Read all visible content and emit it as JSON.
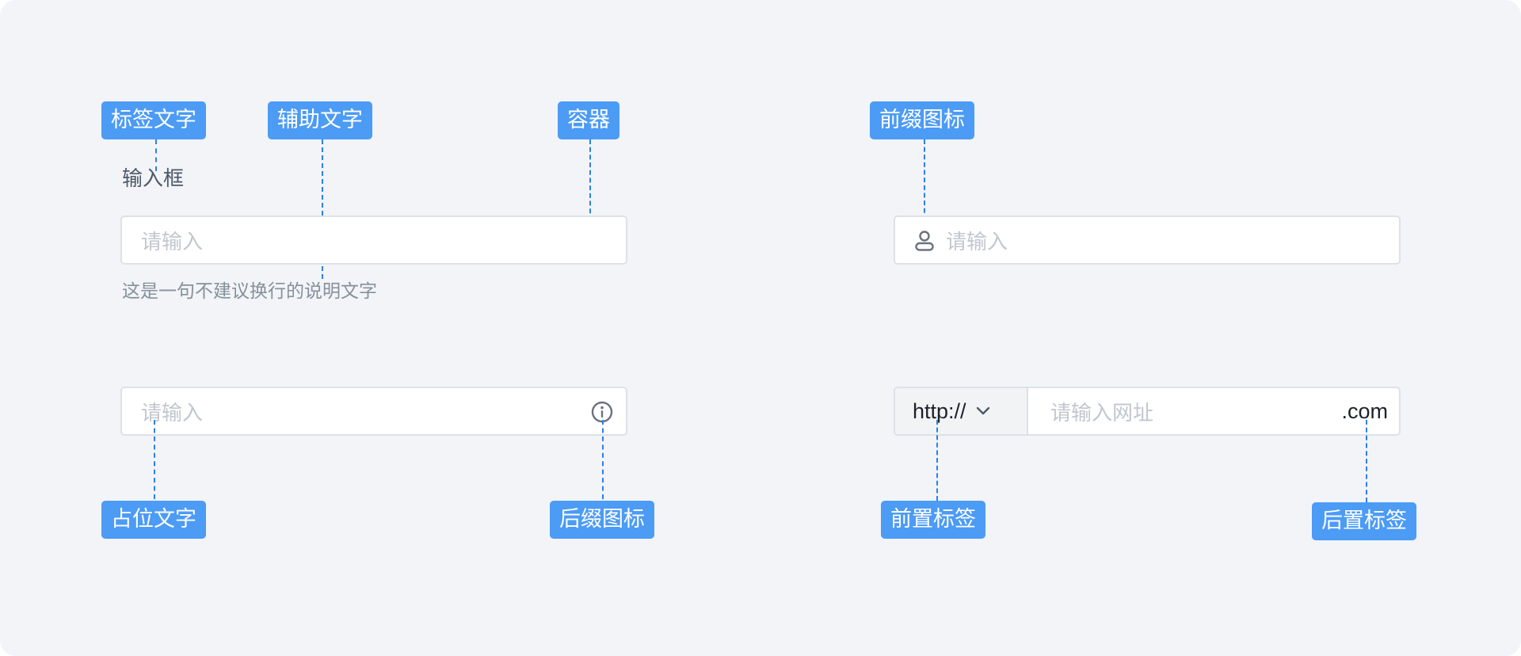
{
  "annotations": {
    "label_text": "标签文字",
    "helper_text": "辅助文字",
    "container": "容器",
    "prefix_icon": "前缀图标",
    "placeholder_text": "占位文字",
    "suffix_icon": "后缀图标",
    "prefix_tag": "前置标签",
    "suffix_tag": "后置标签"
  },
  "input_basic": {
    "label": "输入框",
    "placeholder": "请输入",
    "helper": "这是一句不建议换行的说明文字"
  },
  "input_prefix_icon": {
    "icon": "user-icon",
    "placeholder": "请输入"
  },
  "input_suffix_icon": {
    "icon": "info-icon",
    "placeholder": "请输入"
  },
  "input_addons": {
    "prefix": "http://",
    "prefix_icon": "chevron-down-icon",
    "placeholder": "请输入网址",
    "suffix": ".com"
  },
  "colors": {
    "tag_bg": "#4c9bf5",
    "guide_line": "#2e7fe6",
    "background": "#f2f4f8",
    "border": "#dde1e8",
    "placeholder": "#c2c6cf"
  }
}
